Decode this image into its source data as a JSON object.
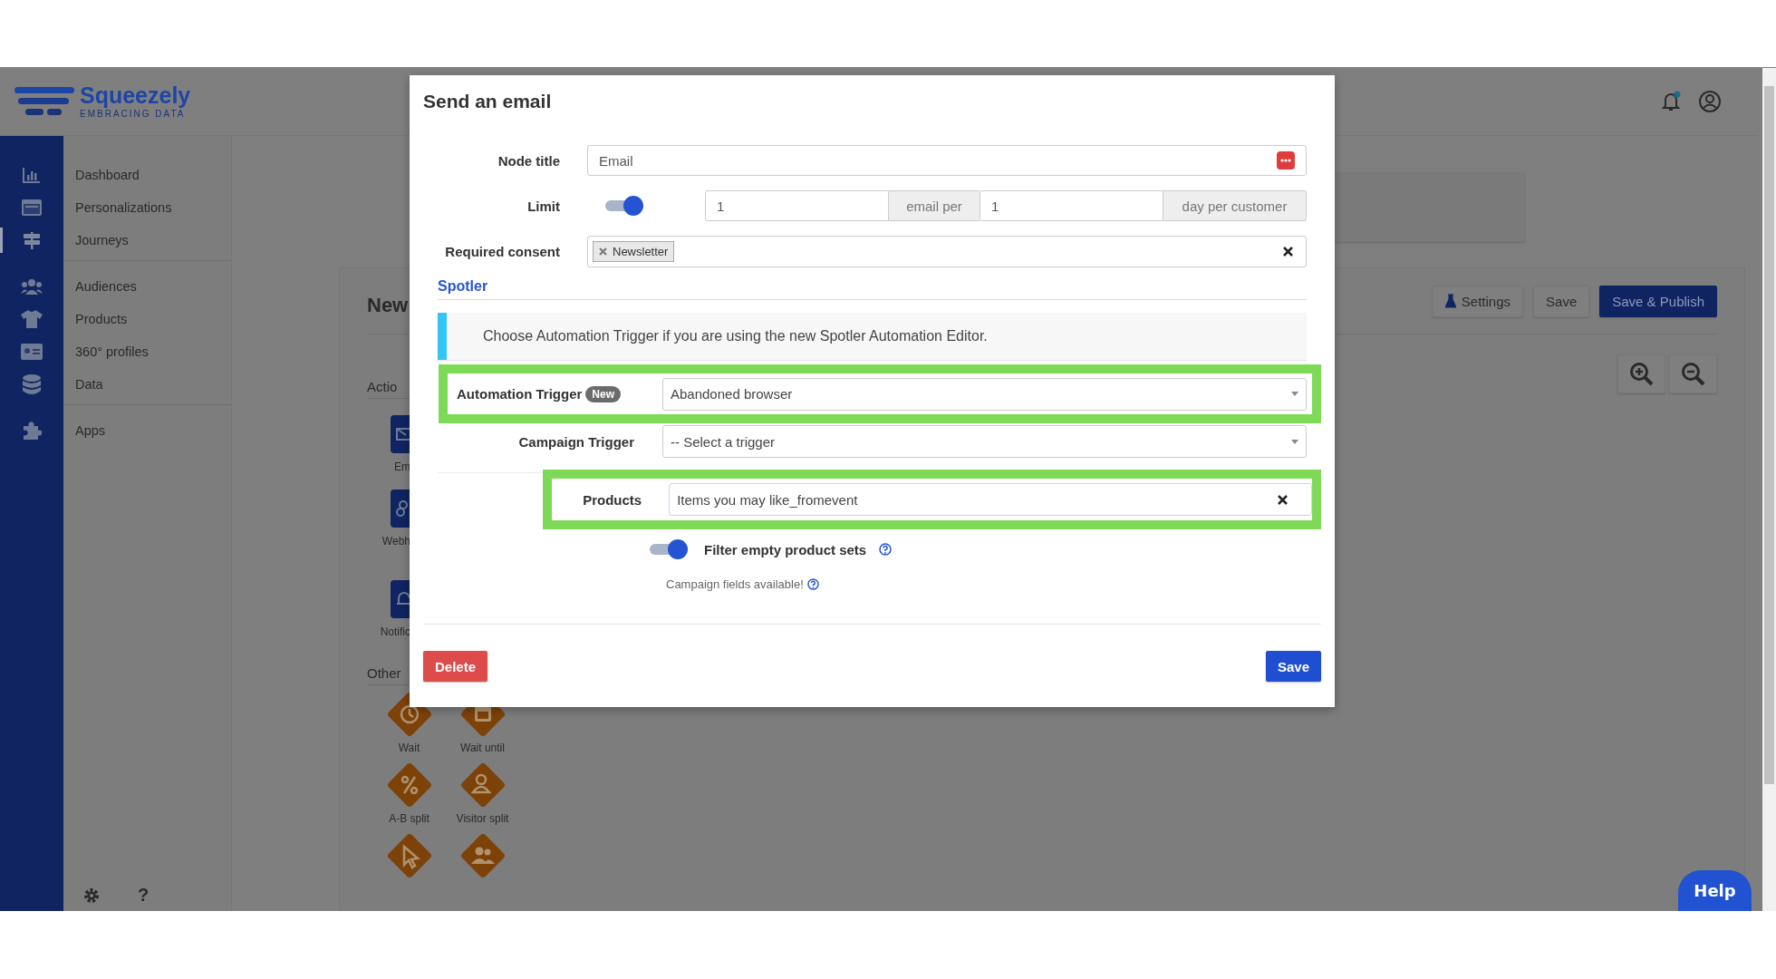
{
  "header": {
    "logo_name": "Squeezely",
    "logo_tagline": "EMBRACING DATA"
  },
  "sidebar": {
    "groups": [
      {
        "items": [
          {
            "label": "Dashboard",
            "selected": false
          },
          {
            "label": "Personalizations",
            "selected": false
          },
          {
            "label": "Journeys",
            "selected": true
          }
        ]
      },
      {
        "items": [
          {
            "label": "Audiences",
            "selected": false
          },
          {
            "label": "Products",
            "selected": false
          },
          {
            "label": "360° profiles",
            "selected": false
          },
          {
            "label": "Data",
            "selected": false
          }
        ]
      },
      {
        "items": [
          {
            "label": "Apps",
            "selected": false
          }
        ]
      }
    ],
    "help_glyph": "?"
  },
  "background": {
    "page_title": "New",
    "buttons": [
      {
        "label": "Settings",
        "kind": "secondary"
      },
      {
        "label": "Save",
        "kind": "secondary"
      },
      {
        "label": "Save & Publish",
        "kind": "primary"
      }
    ],
    "action_heading": "Actio",
    "actions": [
      "Em",
      "Webh",
      "Notific"
    ],
    "other_heading": "Other",
    "others": [
      "Wait",
      "Wait until",
      "A-B split",
      "Visitor split"
    ]
  },
  "modal": {
    "title": "Send an email",
    "node_title": {
      "label": "Node title",
      "value": "Email"
    },
    "limit": {
      "label": "Limit",
      "on": true,
      "count": "1",
      "unit": "email per",
      "period": "1",
      "period_unit": "day per customer"
    },
    "consent": {
      "label": "Required consent",
      "tags": [
        "Newsletter"
      ]
    },
    "section": "Spotler",
    "info": "Choose Automation Trigger if you are using the new Spotler Automation Editor.",
    "automation_trigger": {
      "label": "Automation Trigger",
      "badge": "New",
      "value": "Abandoned browser",
      "highlighted": true
    },
    "campaign_trigger": {
      "label": "Campaign Trigger",
      "value": "-- Select a trigger"
    },
    "products": {
      "label": "Products",
      "value": "Items you may like_fromevent",
      "highlighted": true
    },
    "filter_empty": {
      "label": "Filter empty product sets",
      "on": true
    },
    "campaign_fields": "Campaign fields available!",
    "delete": "Delete",
    "save": "Save"
  },
  "help": "Help"
}
